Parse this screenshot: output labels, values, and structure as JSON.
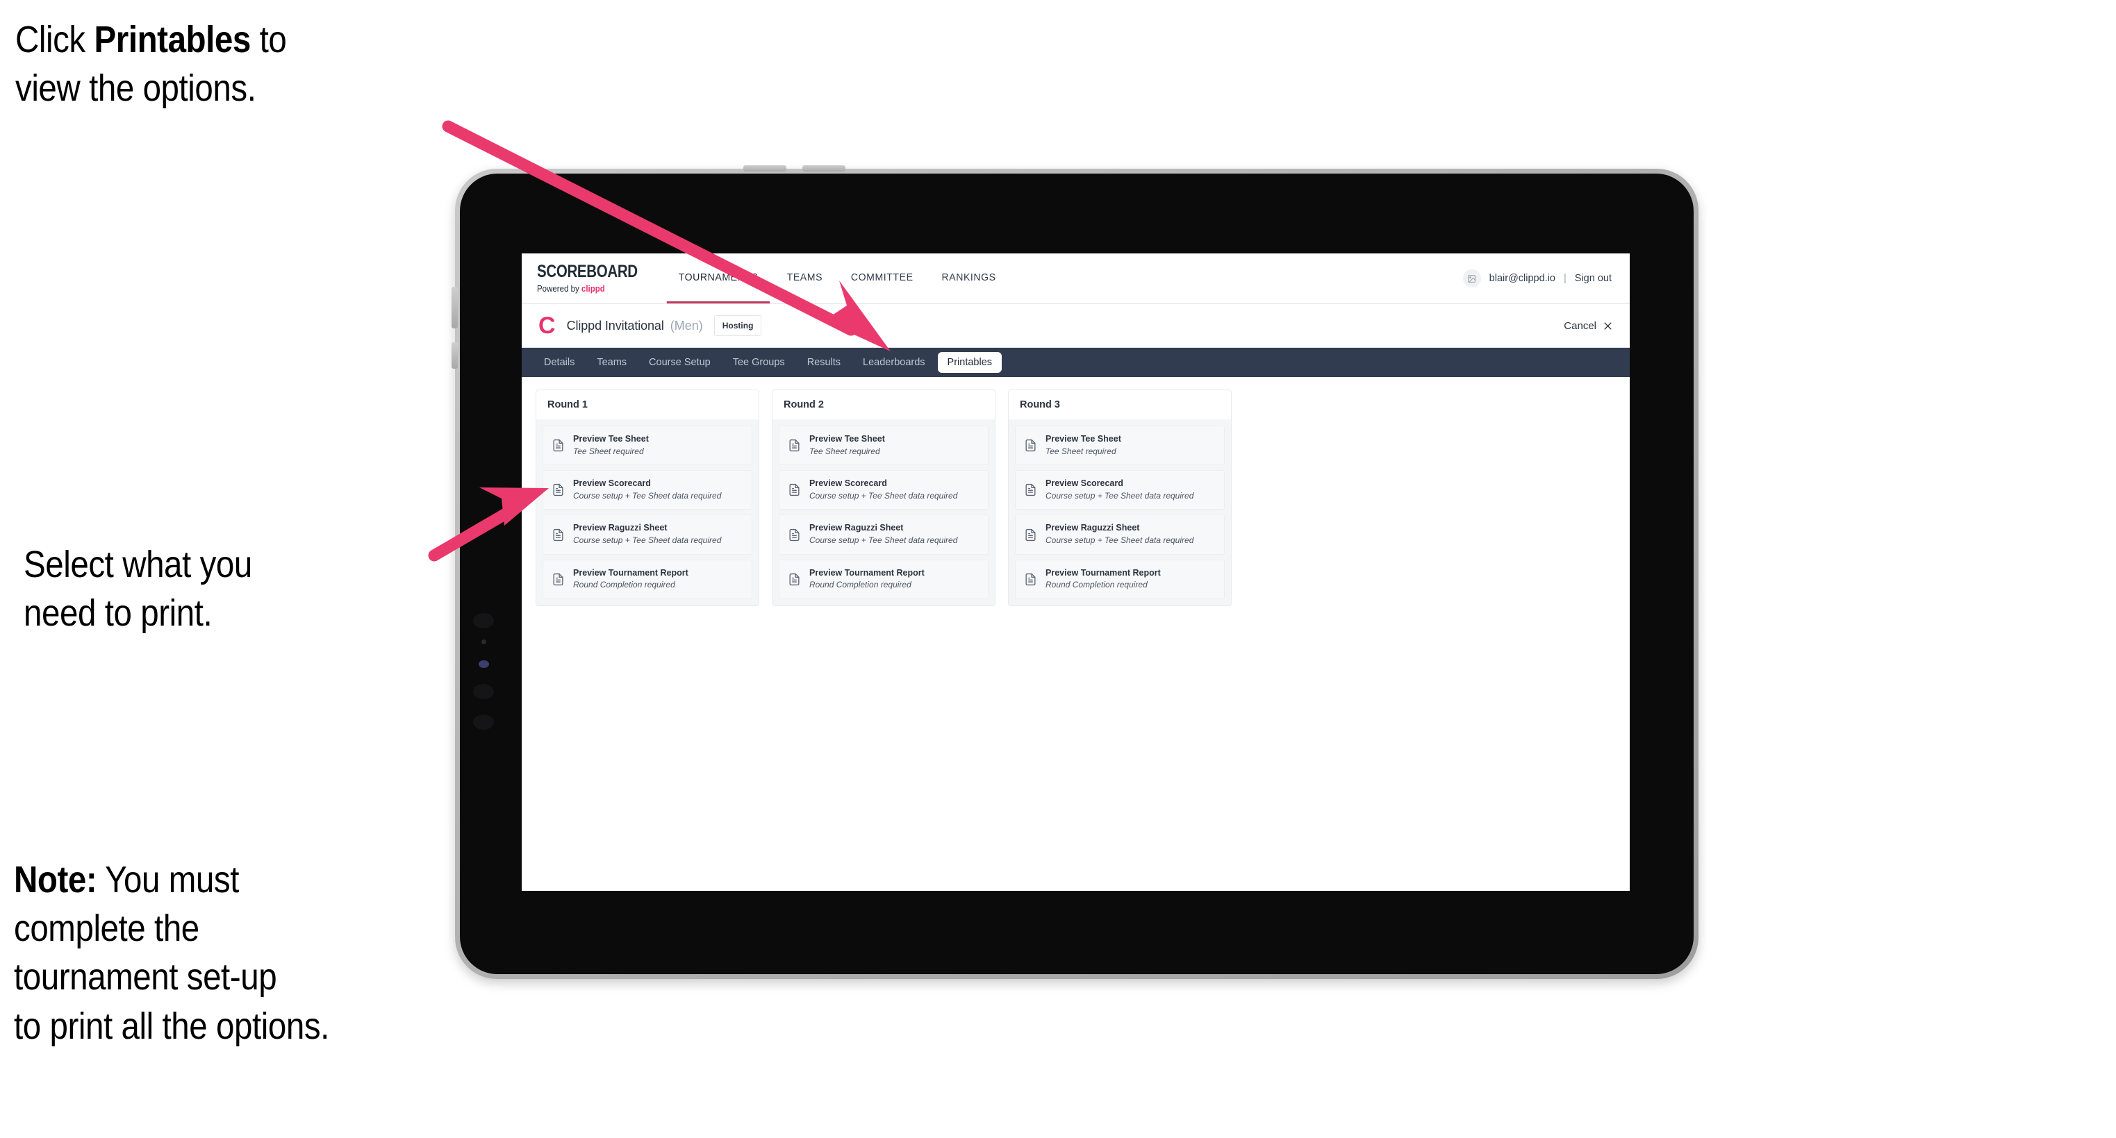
{
  "annotations": {
    "top": {
      "prefix": "Click ",
      "bold": "Printables",
      "suffix": " to\nview the options."
    },
    "middle": {
      "text": "Select what you\n need to print."
    },
    "note": {
      "bold": "Note:",
      "text": " You must\ncomplete the\ntournament set-up\nto print all the options."
    }
  },
  "app": {
    "brand": {
      "word": "SCOREBOARD",
      "powered_prefix": "Powered by ",
      "powered_brand": "clippd"
    },
    "topnav": [
      {
        "label": "TOURNAMENTS",
        "active": true
      },
      {
        "label": "TEAMS",
        "active": false
      },
      {
        "label": "COMMITTEE",
        "active": false
      },
      {
        "label": "RANKINGS",
        "active": false
      }
    ],
    "account": {
      "avatar_icon": "user-photo-icon",
      "email": "blair@clippd.io",
      "separator": "|",
      "sign_out": "Sign out"
    },
    "tournament": {
      "logo_letter": "C",
      "name": "Clippd Invitational",
      "gender": "(Men)",
      "status_badge": "Hosting",
      "cancel_label": "Cancel",
      "cancel_icon": "close-icon"
    },
    "tabs": [
      {
        "label": "Details",
        "active": false
      },
      {
        "label": "Teams",
        "active": false
      },
      {
        "label": "Course Setup",
        "active": false
      },
      {
        "label": "Tee Groups",
        "active": false
      },
      {
        "label": "Results",
        "active": false
      },
      {
        "label": "Leaderboards",
        "active": false
      },
      {
        "label": "Printables",
        "active": true
      }
    ],
    "rounds": [
      {
        "title": "Round 1",
        "items": [
          {
            "title": "Preview Tee Sheet",
            "requirement": "Tee Sheet required",
            "icon": "document-icon"
          },
          {
            "title": "Preview Scorecard",
            "requirement": "Course setup + Tee Sheet data required",
            "icon": "document-icon"
          },
          {
            "title": "Preview Raguzzi Sheet",
            "requirement": "Course setup + Tee Sheet data required",
            "icon": "document-icon"
          },
          {
            "title": "Preview Tournament Report",
            "requirement": "Round Completion required",
            "icon": "document-icon"
          }
        ]
      },
      {
        "title": "Round 2",
        "items": [
          {
            "title": "Preview Tee Sheet",
            "requirement": "Tee Sheet required",
            "icon": "document-icon"
          },
          {
            "title": "Preview Scorecard",
            "requirement": "Course setup + Tee Sheet data required",
            "icon": "document-icon"
          },
          {
            "title": "Preview Raguzzi Sheet",
            "requirement": "Course setup + Tee Sheet data required",
            "icon": "document-icon"
          },
          {
            "title": "Preview Tournament Report",
            "requirement": "Round Completion required",
            "icon": "document-icon"
          }
        ]
      },
      {
        "title": "Round 3",
        "items": [
          {
            "title": "Preview Tee Sheet",
            "requirement": "Tee Sheet required",
            "icon": "document-icon"
          },
          {
            "title": "Preview Scorecard",
            "requirement": "Course setup + Tee Sheet data required",
            "icon": "document-icon"
          },
          {
            "title": "Preview Raguzzi Sheet",
            "requirement": "Course setup + Tee Sheet data required",
            "icon": "document-icon"
          },
          {
            "title": "Preview Tournament Report",
            "requirement": "Round Completion required",
            "icon": "document-icon"
          }
        ]
      }
    ]
  },
  "colors": {
    "accent_pink": "#e8336b",
    "tabstrip_navy": "#323c51",
    "arrow_pink": "#ea3a6d",
    "text_dark": "#2b3440"
  }
}
